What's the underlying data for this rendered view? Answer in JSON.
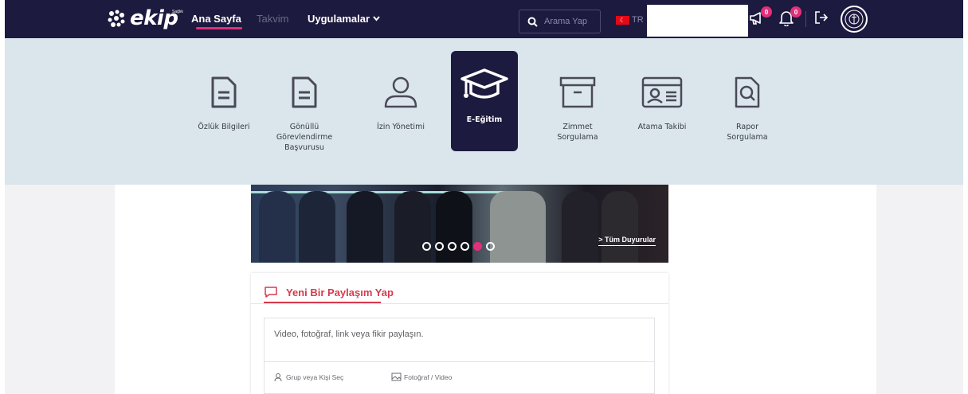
{
  "topbar": {
    "logo_text": "ekip",
    "logo_subtext": "Sağlık",
    "nav": {
      "home": "Ana Sayfa",
      "calendar": "Takvim",
      "apps": "Uygulamalar"
    },
    "search_placeholder": "Arama Yap",
    "language": "TR",
    "announcements_badge": "0",
    "notifications_badge": "0"
  },
  "apps": [
    {
      "label": "Özlük Bilgileri",
      "icon": "document-icon"
    },
    {
      "label": "Gönüllü Görevlendirme Başvurusu",
      "icon": "document-icon"
    },
    {
      "label": "İzin Yönetimi",
      "icon": "person-icon"
    },
    {
      "label": "E-Eğitim",
      "icon": "graduation-cap-icon",
      "active": true
    },
    {
      "label": "Zimmet Sorgulama",
      "icon": "archive-box-icon"
    },
    {
      "label": "Atama Takibi",
      "icon": "id-card-icon"
    },
    {
      "label": "Rapor Sorgulama",
      "icon": "report-search-icon"
    }
  ],
  "banner": {
    "all_announcements": "Tüm Duyurular",
    "dot_count": 6,
    "active_dot": 5
  },
  "share": {
    "tab_label": "Yeni Bir Paylaşım Yap",
    "placeholder": "Video, fotoğraf, link veya fikir paylaşın.",
    "select_people": "Grup veya Kişi Seç",
    "photo_video": "Fotoğraf / Video"
  },
  "colors": {
    "nav_bg": "#1d1a3f",
    "accent_pink": "#e0307a",
    "share_red": "#d53a4e",
    "menu_bg": "#dae5ec"
  }
}
